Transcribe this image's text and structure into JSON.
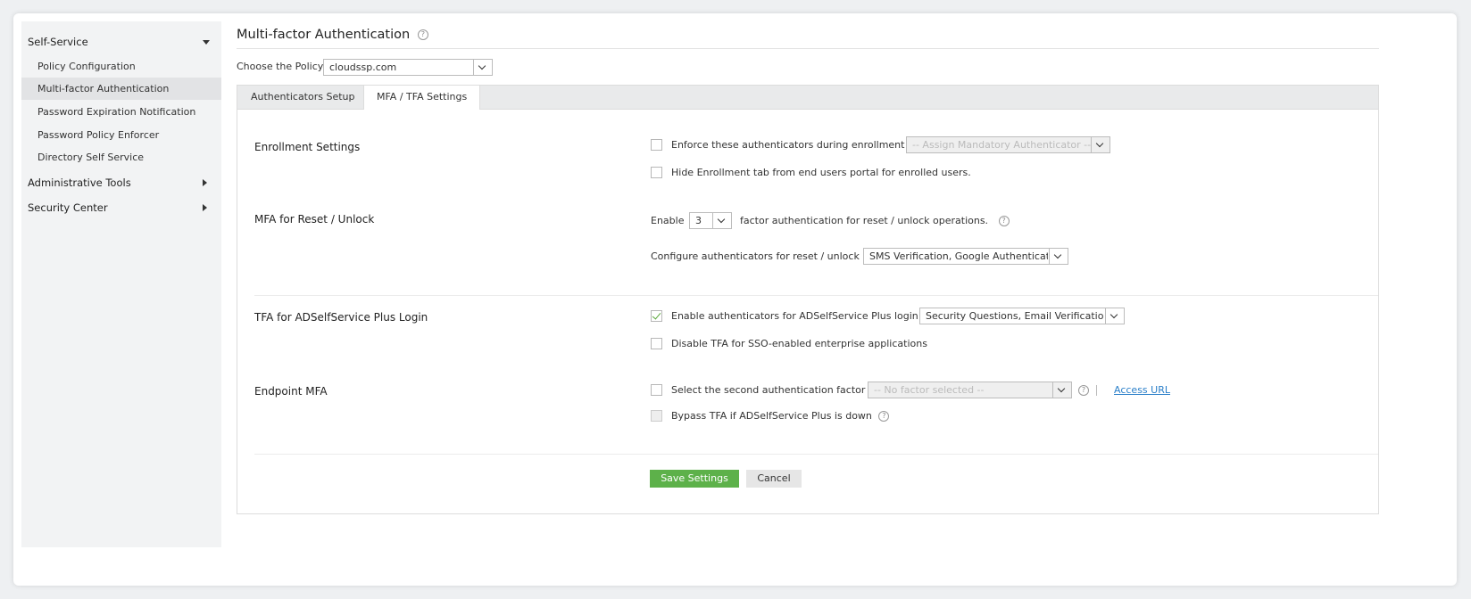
{
  "sidebar": {
    "sections": [
      {
        "label": "Self-Service",
        "expanded": true
      },
      {
        "label": "Administrative Tools",
        "expanded": false
      },
      {
        "label": "Security Center",
        "expanded": false
      }
    ],
    "items": [
      {
        "label": "Policy Configuration"
      },
      {
        "label": "Multi-factor Authentication",
        "active": true
      },
      {
        "label": "Password Expiration Notification"
      },
      {
        "label": "Password Policy Enforcer"
      },
      {
        "label": "Directory Self Service"
      }
    ]
  },
  "page": {
    "title": "Multi-factor Authentication",
    "help_glyph": "?",
    "policy_label": "Choose the Policy",
    "policy_value": "cloudssp.com"
  },
  "tabs": [
    {
      "label": "Authenticators Setup",
      "active": false
    },
    {
      "label": "MFA / TFA Settings",
      "active": true
    }
  ],
  "enrollment": {
    "title": "Enrollment Settings",
    "enforce_label": "Enforce these authenticators during enrollment",
    "enforce_checked": false,
    "mandatory_placeholder": "-- Assign Mandatory Authenticator --",
    "hide_tab_label": "Hide Enrollment tab from end users portal for enrolled users.",
    "hide_tab_checked": false
  },
  "reset_unlock": {
    "title": "MFA for Reset / Unlock",
    "enable_label": "Enable",
    "factor_value": "3",
    "factor_suffix": "factor authentication for reset / unlock operations.",
    "configure_label": "Configure authenticators for reset / unlock",
    "configure_value": "SMS Verification, Google Authenticator"
  },
  "tfa_login": {
    "title": "TFA for ADSelfService Plus Login",
    "enable_label": "Enable authenticators for ADSelfService Plus login",
    "enable_checked": true,
    "authenticators_value": "Security Questions, Email Verification",
    "disable_sso_label": "Disable TFA for SSO-enabled enterprise applications",
    "disable_sso_checked": false
  },
  "endpoint": {
    "title": "Endpoint MFA",
    "select_label": "Select the second authentication factor",
    "factor_placeholder": "-- No factor selected --",
    "access_url": "Access URL",
    "bypass_label": "Bypass TFA if ADSelfService Plus is down"
  },
  "buttons": {
    "save": "Save Settings",
    "cancel": "Cancel"
  },
  "colors": {
    "save_button": "#5db14a",
    "link": "#2a7fc9",
    "sidebar_bg": "#f2f3f4",
    "active_item_bg": "#e2e3e5"
  }
}
